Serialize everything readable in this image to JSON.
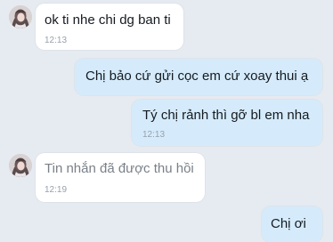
{
  "messages": [
    {
      "direction": "incoming",
      "text": "ok ti nhe chi dg ban ti",
      "time": "12:13"
    },
    {
      "direction": "outgoing",
      "text": "Chị bảo cứ gửi cọc em cứ xoay thui ạ",
      "time": ""
    },
    {
      "direction": "outgoing",
      "text": "Tý chị rảnh thì gỡ bl em nha",
      "time": "12:13"
    },
    {
      "direction": "incoming",
      "text": "Tin nhắn đã được thu hồi",
      "time": "12:19",
      "recalled": true
    },
    {
      "direction": "outgoing",
      "text": "Chị ơi",
      "time": ""
    }
  ],
  "colors": {
    "background": "#e6ebf1",
    "incoming_bubble": "#ffffff",
    "outgoing_bubble": "#d5ebfb",
    "timestamp": "#97a1ad"
  }
}
